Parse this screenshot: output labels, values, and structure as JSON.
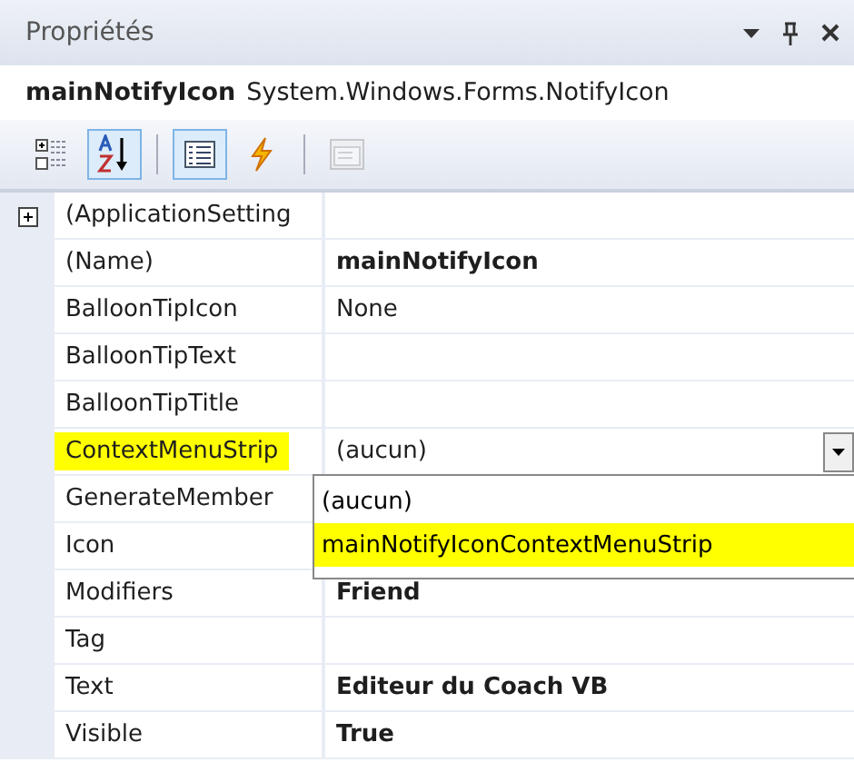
{
  "window": {
    "title": "Propriétés"
  },
  "object_selector": {
    "name": "mainNotifyIcon",
    "type": "System.Windows.Forms.NotifyIcon"
  },
  "toolbar": [
    {
      "kind": "categorized",
      "selected": false,
      "disabled": false
    },
    {
      "kind": "alphabetical",
      "selected": true,
      "disabled": false
    },
    {
      "kind": "separator"
    },
    {
      "kind": "properties",
      "selected": true,
      "disabled": false
    },
    {
      "kind": "events",
      "selected": false,
      "disabled": false
    },
    {
      "kind": "separator"
    },
    {
      "kind": "pages",
      "selected": false,
      "disabled": true
    }
  ],
  "properties": [
    {
      "name": "(ApplicationSetting",
      "highlighted": false,
      "expanded": false
    },
    {
      "name": "(Name)",
      "value": "mainNotifyIcon",
      "modified": true,
      "highlighted": false
    },
    {
      "name": "BalloonTipIcon",
      "value": "None",
      "modified": false,
      "highlighted": false
    },
    {
      "name": "BalloonTipText",
      "highlighted": false
    },
    {
      "name": "BalloonTipTitle",
      "highlighted": false
    },
    {
      "name": "ContextMenuStrip",
      "value": "(aucun)",
      "modified": false,
      "highlighted": true,
      "editing": true
    },
    {
      "name": "GenerateMember",
      "highlighted": false
    },
    {
      "name": "Icon",
      "highlighted": false
    },
    {
      "name": "Modifiers",
      "value": "Friend",
      "modified": true,
      "highlighted": false
    },
    {
      "name": "Tag",
      "highlighted": false
    },
    {
      "name": "Text",
      "value": "Editeur du Coach VB",
      "modified": true,
      "highlighted": false
    },
    {
      "name": "Visible",
      "value": "True",
      "modified": true,
      "highlighted": false
    }
  ],
  "dropdown": {
    "options": [
      {
        "label": "(aucun)",
        "selected": false
      },
      {
        "label": "mainNotifyIconContextMenuStrip",
        "selected": true
      }
    ]
  }
}
